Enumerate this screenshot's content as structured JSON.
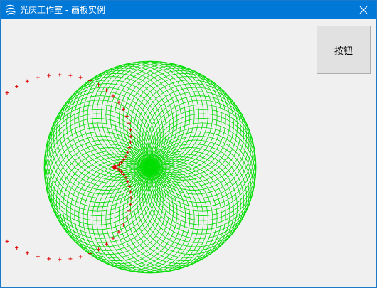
{
  "window": {
    "title": "光庆工作室  - 画板实例",
    "app_icon": "scribble-logo-icon",
    "close_icon": "close-icon"
  },
  "toolbar": {
    "button_label": "按钮"
  },
  "drawing": {
    "pattern": "spirograph-ring",
    "line_color": "#00dd00",
    "marker_color": "#dd0000",
    "marker_glyph": "+",
    "background": "#f0f0f0"
  },
  "colors": {
    "titlebar": "#0078d7",
    "title_text": "#ffffff",
    "button_face": "#e1e1e1",
    "button_border": "#adadad"
  }
}
